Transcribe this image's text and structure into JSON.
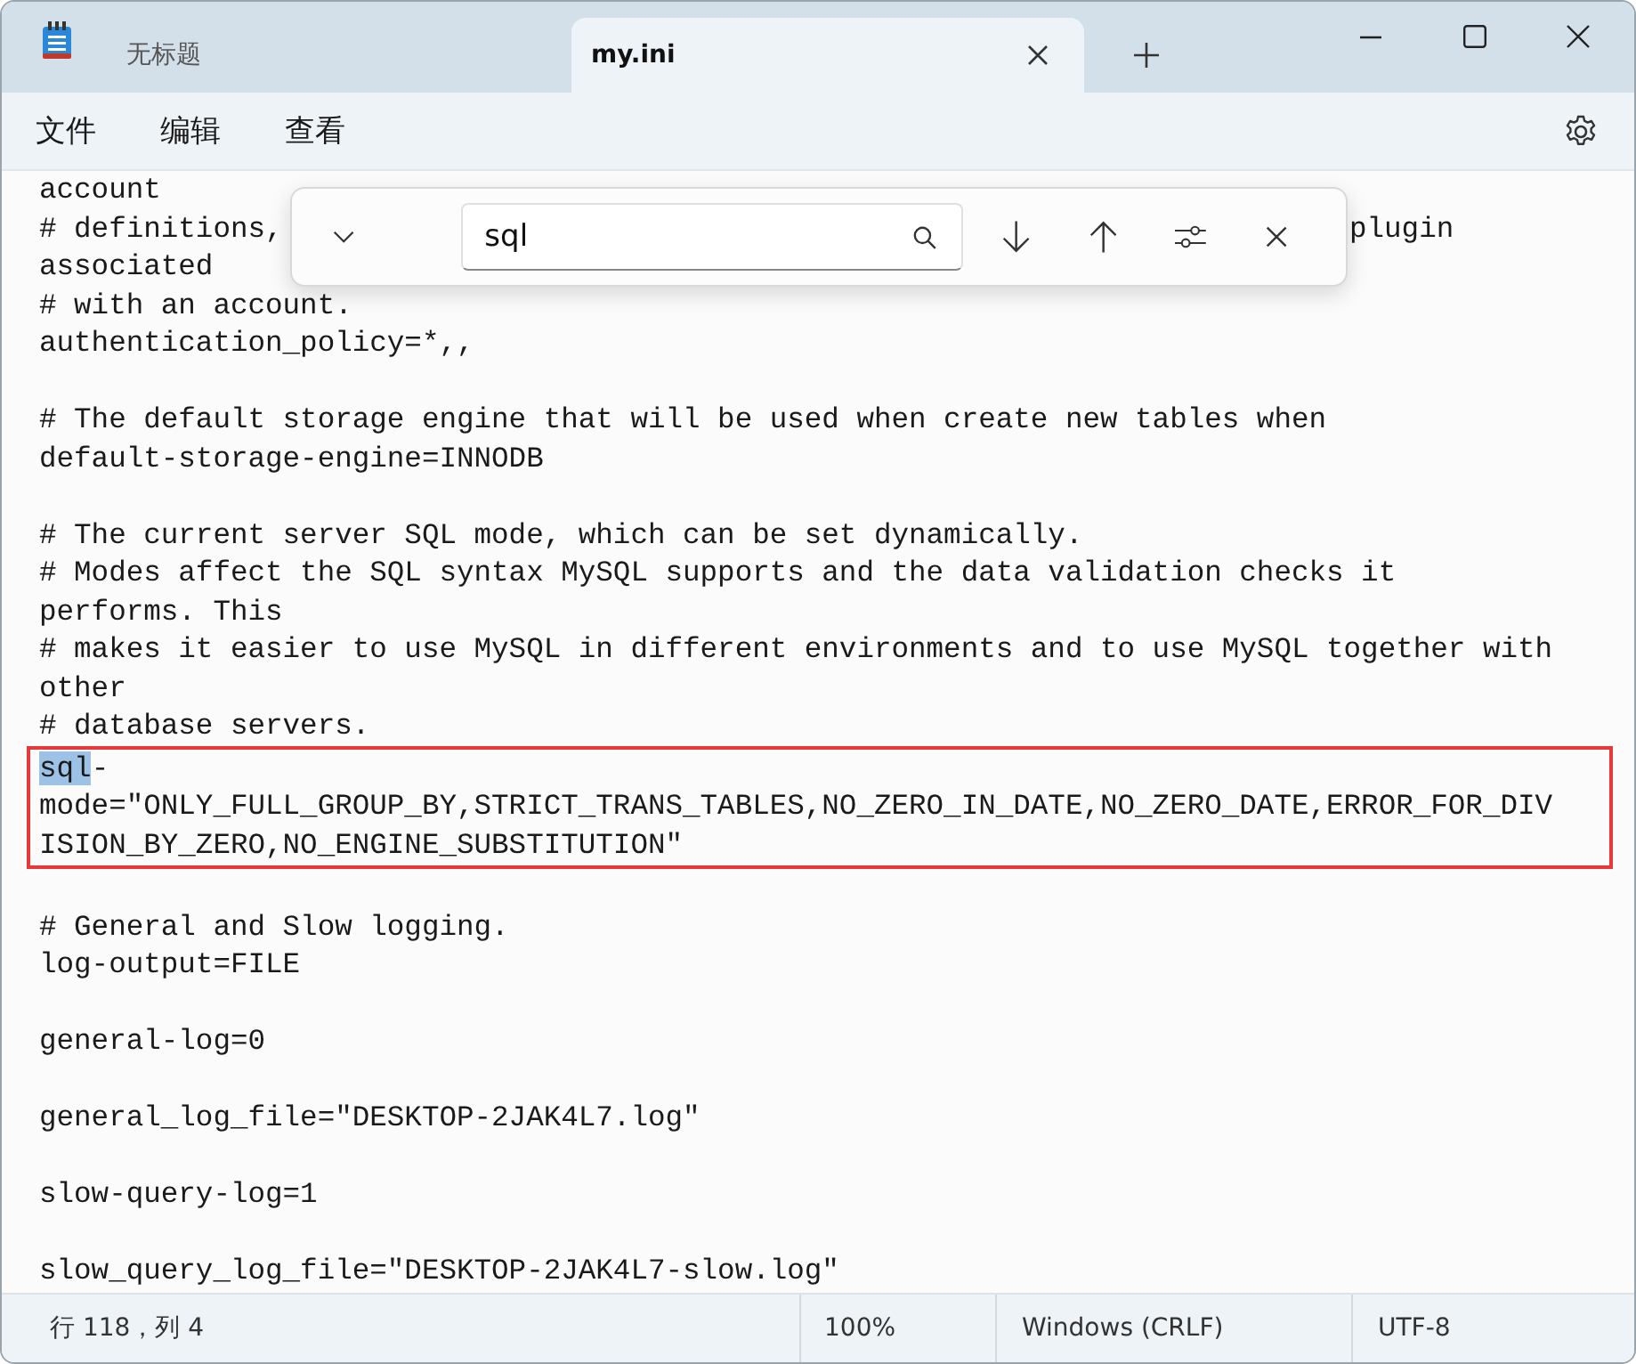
{
  "tabs": [
    {
      "label": "无标题",
      "selected": false
    },
    {
      "label": "my.ini",
      "selected": true
    }
  ],
  "menu": [
    "文件",
    "编辑",
    "查看"
  ],
  "find": {
    "value": "sql"
  },
  "editor": {
    "segments": [
      {
        "kind": "plain",
        "lines": [
          {
            "kind": "text",
            "text": "account"
          },
          {
            "kind": "split",
            "text": "# definitions,",
            "tail": "plugin"
          },
          {
            "kind": "text",
            "text": "associated"
          },
          {
            "kind": "text",
            "text": "# with an account."
          },
          {
            "kind": "text",
            "text": "authentication_policy=*,,"
          },
          {
            "kind": "blank"
          },
          {
            "kind": "text",
            "text": "# The default storage engine that will be used when create new tables when"
          },
          {
            "kind": "text",
            "text": "default-storage-engine=INNODB"
          },
          {
            "kind": "blank"
          },
          {
            "kind": "text",
            "text": "# The current server SQL mode, which can be set dynamically."
          },
          {
            "kind": "text",
            "text": "# Modes affect the SQL syntax MySQL supports and the data validation checks it"
          },
          {
            "kind": "text",
            "text": "performs. This"
          },
          {
            "kind": "text",
            "text": "# makes it easier to use MySQL in different environments and to use MySQL together with"
          },
          {
            "kind": "text",
            "text": "other"
          },
          {
            "kind": "text",
            "text": "# database servers."
          }
        ]
      },
      {
        "kind": "boxed",
        "lines": [
          {
            "kind": "match",
            "match": "sql",
            "text": "-"
          },
          {
            "kind": "text",
            "text": "mode=\"ONLY_FULL_GROUP_BY,STRICT_TRANS_TABLES,NO_ZERO_IN_DATE,NO_ZERO_DATE,ERROR_FOR_DIV"
          },
          {
            "kind": "text",
            "text": "ISION_BY_ZERO,NO_ENGINE_SUBSTITUTION\""
          }
        ]
      },
      {
        "kind": "plain",
        "lines": [
          {
            "kind": "blank"
          },
          {
            "kind": "text",
            "text": "# General and Slow logging."
          },
          {
            "kind": "text",
            "text": "log-output=FILE"
          },
          {
            "kind": "blank"
          },
          {
            "kind": "text",
            "text": "general-log=0"
          },
          {
            "kind": "blank"
          },
          {
            "kind": "text",
            "text": "general_log_file=\"DESKTOP-2JAK4L7.log\""
          },
          {
            "kind": "blank"
          },
          {
            "kind": "text",
            "text": "slow-query-log=1"
          },
          {
            "kind": "blank"
          },
          {
            "kind": "text",
            "text": "slow_query_log_file=\"DESKTOP-2JAK4L7-slow.log\""
          }
        ]
      }
    ]
  },
  "status_bar": {
    "position": "行 118，列 4",
    "zoom": "100%",
    "line_ending": "Windows (CRLF)",
    "encoding": "UTF-8"
  }
}
